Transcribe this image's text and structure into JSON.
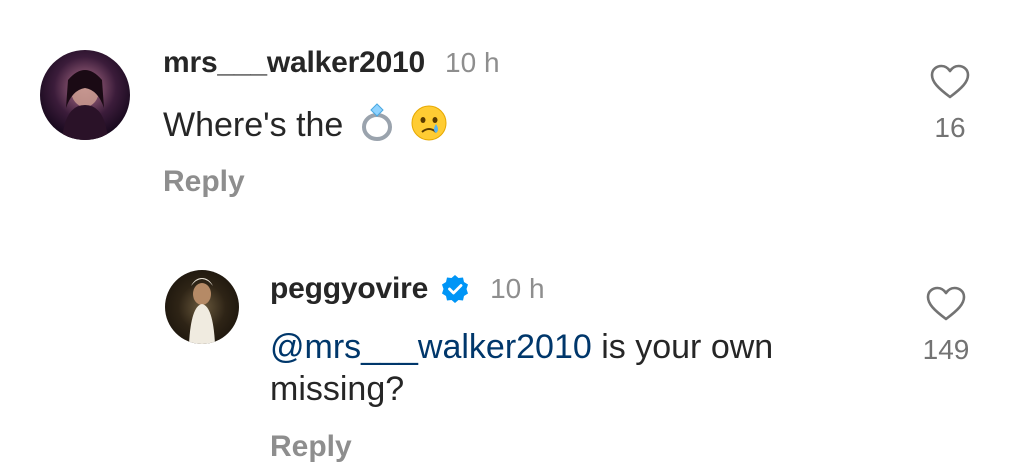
{
  "comments": [
    {
      "username": "mrs___walker2010",
      "time": "10 h",
      "text": "Where's the",
      "emojis": [
        "ring-emoji",
        "crying-face-emoji"
      ],
      "reply_label": "Reply",
      "likes": "16"
    },
    {
      "username": "peggyovire",
      "verified": true,
      "time": "10 h",
      "mention": "@mrs___walker2010",
      "text": " is your own missing?",
      "reply_label": "Reply",
      "likes": "149"
    }
  ],
  "colors": {
    "text": "#262626",
    "muted": "#8e8e8e",
    "mention": "#00376b",
    "verified": "#0095f6"
  }
}
